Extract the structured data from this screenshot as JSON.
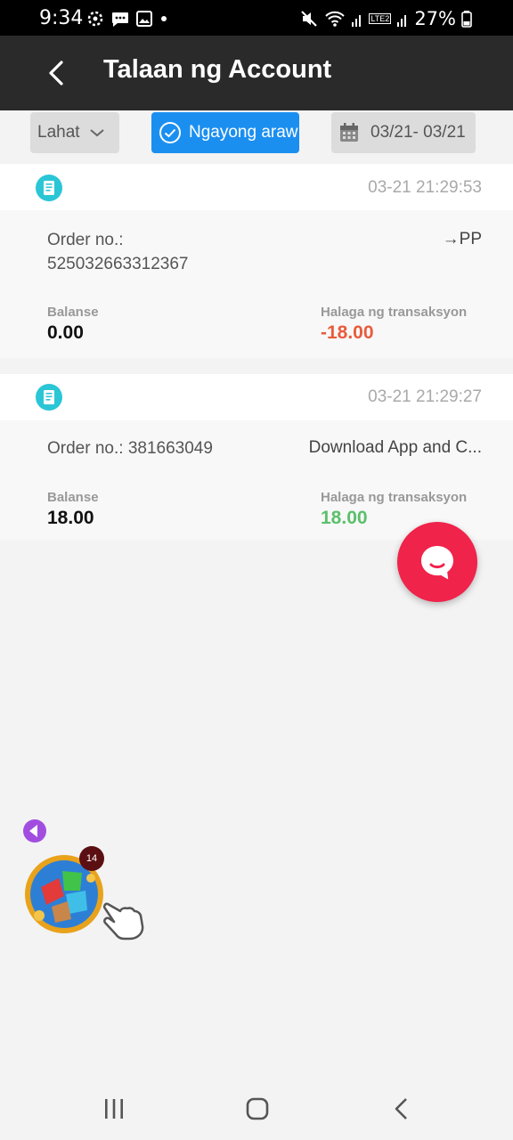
{
  "status_bar": {
    "time": "9:34",
    "battery": "27%",
    "network_label": "LTE2"
  },
  "header": {
    "title": "Talaan ng Account"
  },
  "filters": {
    "all_label": "Lahat",
    "today_label": "Ngayong araw",
    "date_range": "03/21- 03/21"
  },
  "transactions": [
    {
      "timestamp": "03-21 21:29:53",
      "order_no": "Order no.: 525032663312367",
      "description": "→PP",
      "balance_label": "Balanse",
      "balance": "0.00",
      "amount_label": "Halaga ng transaksyon",
      "amount": "-18.00",
      "amount_color": "#e95b3b"
    },
    {
      "timestamp": "03-21 21:29:27",
      "order_no": "Order no.: 381663049",
      "description": "Download App and C...",
      "balance_label": "Balanse",
      "balance": "18.00",
      "amount_label": "Halaga ng transaksyon",
      "amount": "18.00",
      "amount_color": "#5cc06b"
    }
  ],
  "floating_badge": "14",
  "colors": {
    "accent": "#1b8ff0",
    "chat_fab": "#f0234a",
    "negative": "#e95b3b",
    "positive": "#5cc06b"
  }
}
